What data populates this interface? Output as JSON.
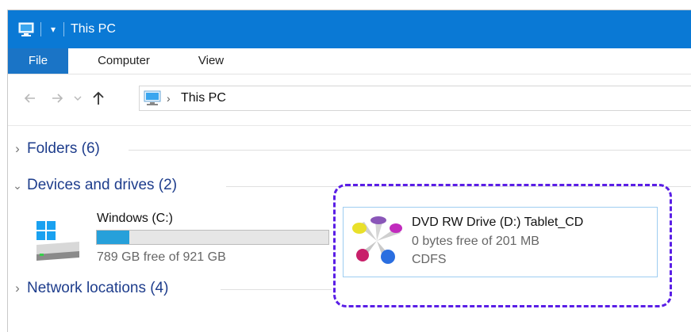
{
  "window": {
    "title": "This PC",
    "accent_color": "#0a79d5"
  },
  "ribbon": {
    "tabs": [
      {
        "label": "File"
      },
      {
        "label": "Computer"
      },
      {
        "label": "View"
      }
    ]
  },
  "address": {
    "location": "This PC",
    "icons": [
      "back-arrow-icon",
      "forward-arrow-icon",
      "recent-chevron-icon",
      "up-arrow-icon",
      "computer-icon",
      "breadcrumb-separator-icon"
    ]
  },
  "groups": {
    "folders": {
      "label": "Folders (6)",
      "expanded": false
    },
    "devices": {
      "label": "Devices and drives (2)",
      "expanded": true
    },
    "network": {
      "label": "Network locations (4)",
      "expanded": false
    }
  },
  "drives": [
    {
      "name": "Windows (C:)",
      "free_text": "789 GB free of 921 GB",
      "used_fraction": 0.14,
      "icon": "windows-drive-icon"
    },
    {
      "name": "DVD RW Drive (D:) Tablet_CD",
      "free_text": "0 bytes free of 201 MB",
      "filesystem": "CDFS",
      "icon": "tablet-cd-icon",
      "selected": true
    }
  ]
}
